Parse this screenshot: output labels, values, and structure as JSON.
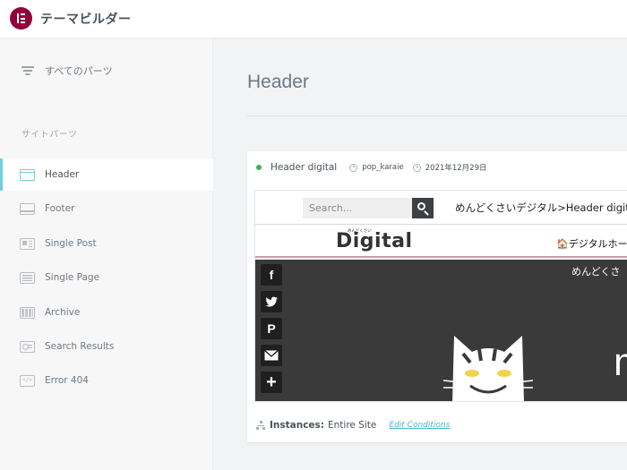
{
  "app": {
    "title": "テーマビルダー"
  },
  "sidebar": {
    "all_parts_label": "すべてのパーツ",
    "section_label": "サイトパーツ",
    "items": [
      {
        "label": "Header",
        "icon": "header-icon",
        "active": true
      },
      {
        "label": "Footer",
        "icon": "footer-icon"
      },
      {
        "label": "Single Post",
        "icon": "single-post-icon"
      },
      {
        "label": "Single Page",
        "icon": "single-page-icon"
      },
      {
        "label": "Archive",
        "icon": "archive-icon"
      },
      {
        "label": "Search Results",
        "icon": "search-results-icon"
      },
      {
        "label": "Error 404",
        "icon": "error-404-icon"
      }
    ]
  },
  "main": {
    "title": "Header",
    "card": {
      "status": "active",
      "template_name": "Header digital",
      "author": "pop_karaie",
      "date": "2021年12月29日",
      "instances_label": "Instances:",
      "instances_value": "Entire Site",
      "edit_conditions_label": "Edit Conditions",
      "preview": {
        "search_placeholder": "Search...",
        "breadcrumb": "めんどくさいデジタル>Header digit",
        "logo_small": "めんどくさい",
        "logo": "Digital",
        "home_link": "🏠デジタルホーム",
        "hero_text": "めんどくさ",
        "hero_big": "m"
      }
    }
  },
  "colors": {
    "brand": "#92003b",
    "accent": "#6fcfdf",
    "status_active": "#39b54a",
    "link": "#4bb4cc"
  }
}
